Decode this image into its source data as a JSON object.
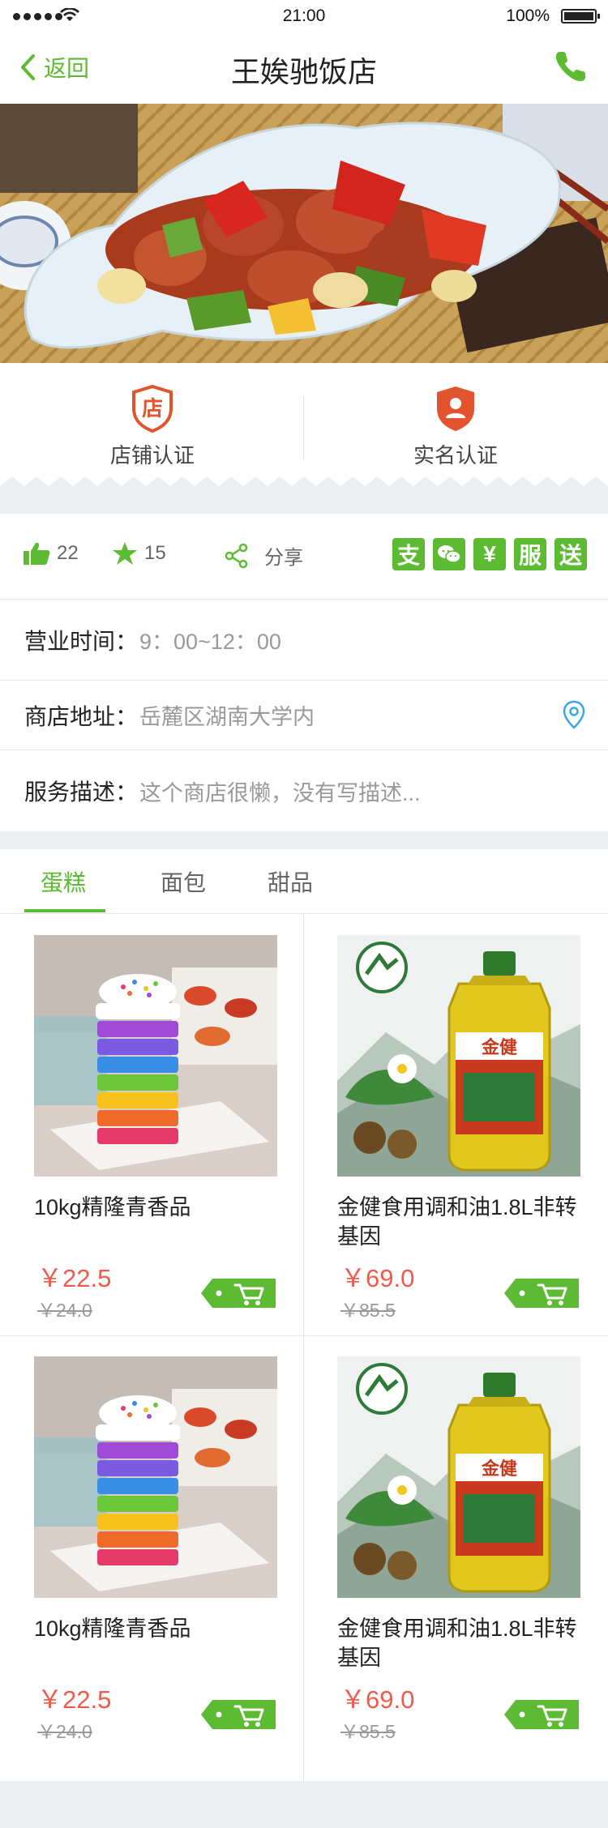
{
  "status_bar": {
    "time": "21:00",
    "battery": "100%"
  },
  "nav": {
    "back_label": "返回",
    "title": "王娭驰饭店"
  },
  "certifications": [
    {
      "icon_text": "店",
      "label": "店铺认证"
    },
    {
      "label": "实名认证"
    }
  ],
  "actions": {
    "likes": "22",
    "favorites": "15",
    "share_label": "分享",
    "payment_badges": [
      "支",
      "微信",
      "¥",
      "服",
      "送"
    ]
  },
  "info": {
    "hours_label": "营业时间：",
    "hours_value": "9：00~12：00",
    "address_label": "商店地址：",
    "address_value": "岳麓区湖南大学内",
    "description_label": "服务描述：",
    "description_value": "这个商店很懒，没有写描述..."
  },
  "tabs": [
    {
      "label": "蛋糕",
      "active": true
    },
    {
      "label": "面包",
      "active": false
    },
    {
      "label": "甜品",
      "active": false
    }
  ],
  "products": [
    {
      "name": "10kg精隆青香品",
      "price": "￥22.5",
      "old_price": "￥24.0",
      "image": "rainbow-cake"
    },
    {
      "name": "金健食用调和油1.8L非转基因",
      "price": "￥69.0",
      "old_price": "￥85.5",
      "image": "oil-bottle",
      "label_text": "金健"
    },
    {
      "name": "10kg精隆青香品",
      "price": "￥22.5",
      "old_price": "￥24.0",
      "image": "rainbow-cake"
    },
    {
      "name": "金健食用调和油1.8L非转基因",
      "price": "￥69.0",
      "old_price": "￥85.5",
      "image": "oil-bottle",
      "label_text": "金健"
    }
  ],
  "colors": {
    "accent": "#5cbb33",
    "price": "#f05a4a",
    "cert_red": "#e2542d"
  }
}
